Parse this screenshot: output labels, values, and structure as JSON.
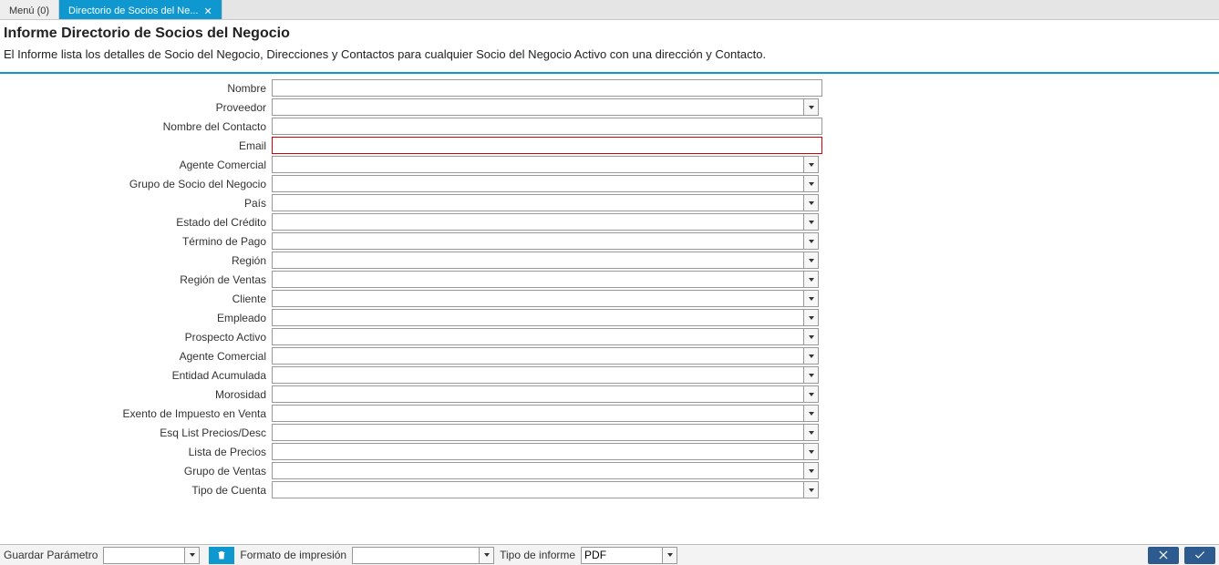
{
  "tabs": {
    "menu": "Menú (0)",
    "active": "Directorio de Socios del Ne..."
  },
  "report": {
    "title": "Informe Directorio de Socios del Negocio",
    "description": "El Informe lista los detalles de Socio del Negocio, Direcciones y Contactos para cualquier Socio del Negocio Activo con una dirección y Contacto."
  },
  "fields": [
    {
      "label": "Nombre",
      "type": "text",
      "value": "",
      "error": false
    },
    {
      "label": "Proveedor",
      "type": "combo",
      "value": "",
      "error": false
    },
    {
      "label": "Nombre del Contacto",
      "type": "text",
      "value": "",
      "error": false
    },
    {
      "label": "Email",
      "type": "text",
      "value": "",
      "error": true
    },
    {
      "label": "Agente Comercial",
      "type": "combo",
      "value": "",
      "error": false
    },
    {
      "label": "Grupo de Socio del Negocio",
      "type": "combo",
      "value": "",
      "error": false
    },
    {
      "label": "País",
      "type": "combo",
      "value": "",
      "error": false
    },
    {
      "label": "Estado del Crédito",
      "type": "combo",
      "value": "",
      "error": false
    },
    {
      "label": "Término de Pago",
      "type": "combo",
      "value": "",
      "error": false
    },
    {
      "label": "Región",
      "type": "combo",
      "value": "",
      "error": false
    },
    {
      "label": "Región de Ventas",
      "type": "combo",
      "value": "",
      "error": false
    },
    {
      "label": "Cliente",
      "type": "combo",
      "value": "",
      "error": false
    },
    {
      "label": "Empleado",
      "type": "combo",
      "value": "",
      "error": false
    },
    {
      "label": "Prospecto Activo",
      "type": "combo",
      "value": "",
      "error": false
    },
    {
      "label": "Agente Comercial",
      "type": "combo",
      "value": "",
      "error": false
    },
    {
      "label": "Entidad Acumulada",
      "type": "combo",
      "value": "",
      "error": false
    },
    {
      "label": "Morosidad",
      "type": "combo",
      "value": "",
      "error": false
    },
    {
      "label": "Exento de Impuesto en Venta",
      "type": "combo",
      "value": "",
      "error": false
    },
    {
      "label": "Esq List Precios/Desc",
      "type": "combo",
      "value": "",
      "error": false
    },
    {
      "label": "Lista de Precios",
      "type": "combo",
      "value": "",
      "error": false
    },
    {
      "label": "Grupo de Ventas",
      "type": "combo",
      "value": "",
      "error": false
    },
    {
      "label": "Tipo de Cuenta",
      "type": "combo",
      "value": "",
      "error": false
    }
  ],
  "footer": {
    "save_param_label": "Guardar Parámetro",
    "save_param_value": "",
    "print_format_label": "Formato de impresión",
    "print_format_value": "",
    "report_type_label": "Tipo de informe",
    "report_type_value": "PDF"
  }
}
